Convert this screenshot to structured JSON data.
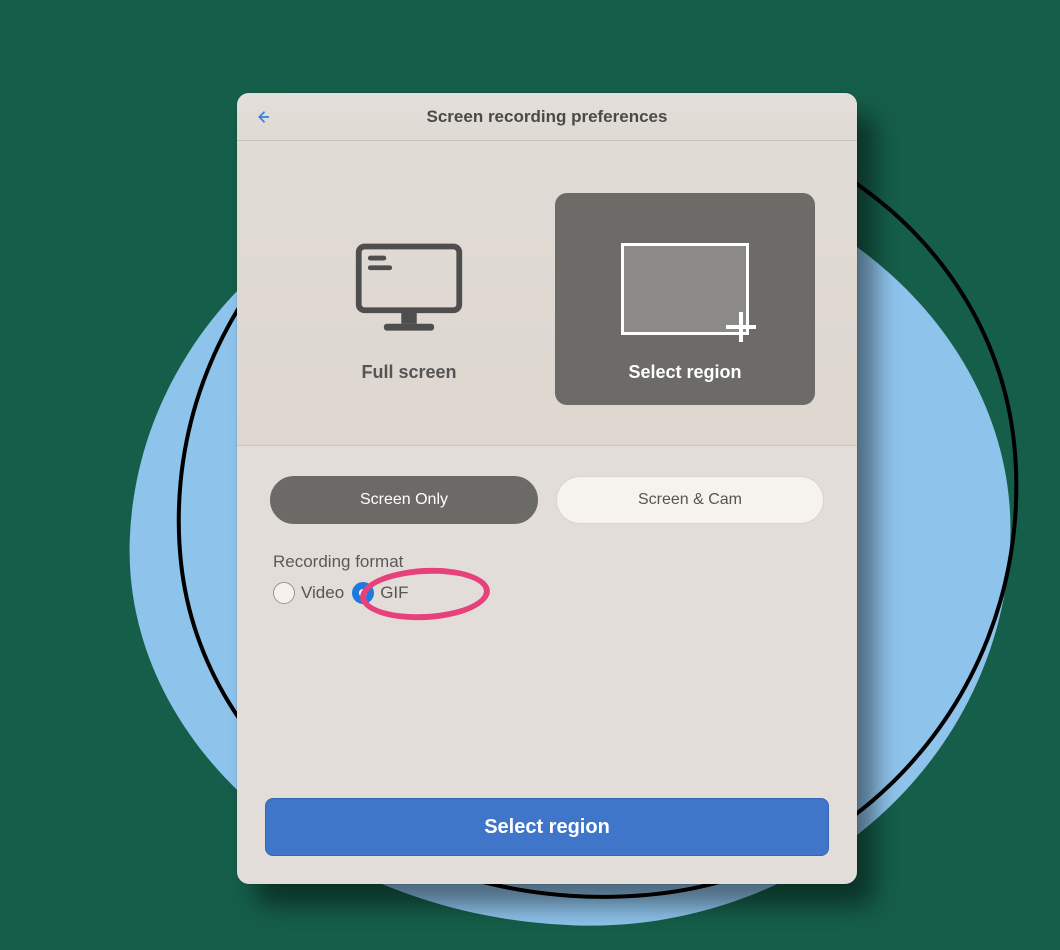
{
  "header": {
    "title": "Screen recording preferences",
    "back_icon": "arrow-left"
  },
  "capture_modes": {
    "fullscreen": {
      "label": "Full screen",
      "selected": false
    },
    "region": {
      "label": "Select region",
      "selected": true
    }
  },
  "source": {
    "screen_only": {
      "label": "Screen Only",
      "selected": true
    },
    "screen_cam": {
      "label": "Screen & Cam",
      "selected": false
    }
  },
  "format": {
    "section_label": "Recording format",
    "options": {
      "video": {
        "label": "Video",
        "checked": false
      },
      "gif": {
        "label": "GIF",
        "checked": true
      }
    }
  },
  "primary_action": {
    "label": "Select region"
  },
  "annotation": {
    "highlight_target": "format.gif"
  }
}
